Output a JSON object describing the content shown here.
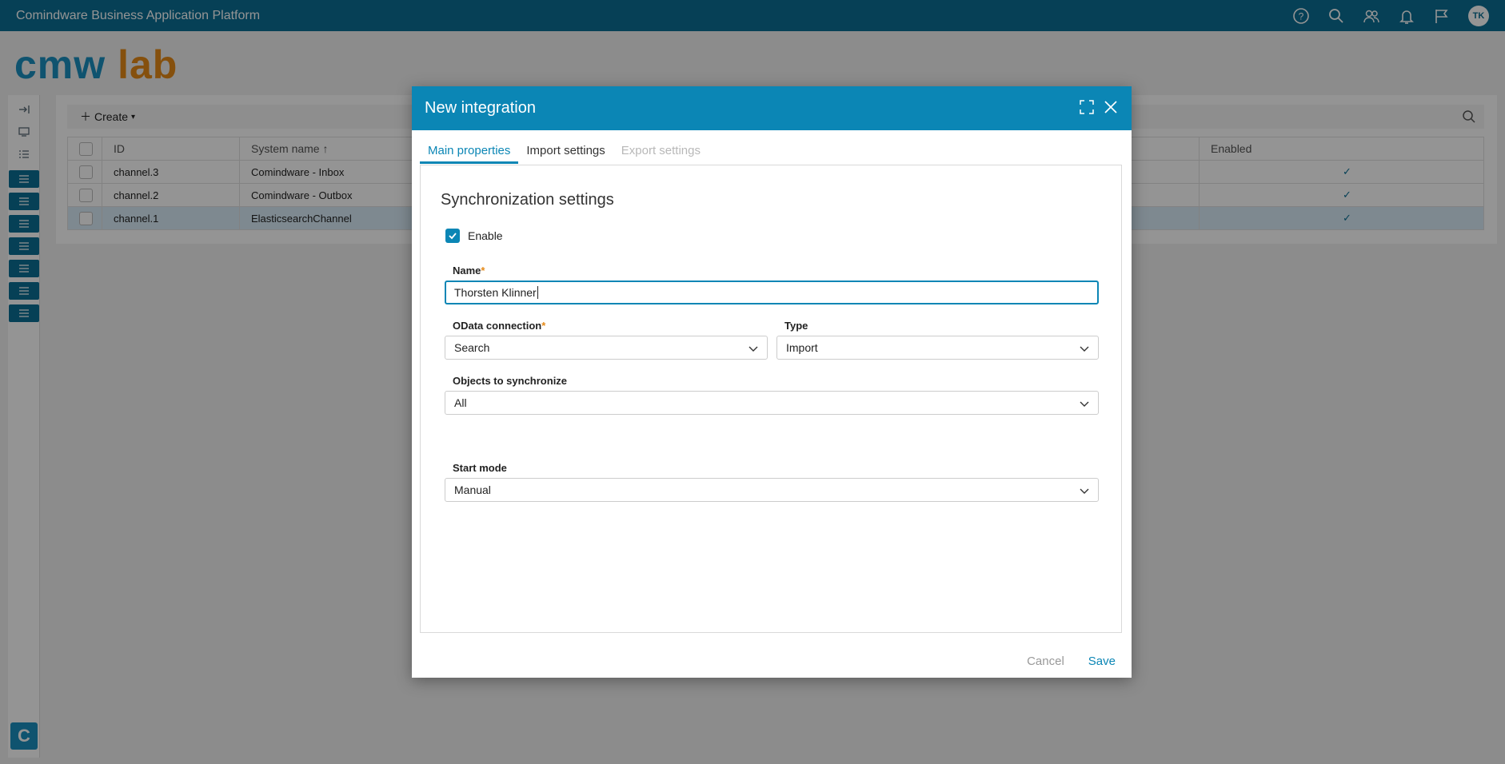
{
  "app": {
    "title": "Comindware Business Application Platform",
    "avatar": "TK"
  },
  "logo": {
    "part1": "cmw",
    "part2": "lab"
  },
  "toolbar": {
    "create_label": "Create"
  },
  "table": {
    "headers": {
      "id": "ID",
      "system_name": "System name ↑",
      "enabled": "Enabled"
    },
    "rows": [
      {
        "id": "channel.3",
        "system_name": "Comindware - Inbox",
        "enabled": "✓"
      },
      {
        "id": "channel.2",
        "system_name": "Comindware - Outbox",
        "enabled": "✓"
      },
      {
        "id": "channel.1",
        "system_name": "ElasticsearchChannel",
        "enabled": "✓"
      }
    ]
  },
  "dialog": {
    "title": "New integration",
    "tabs": [
      "Main properties",
      "Import settings",
      "Export settings"
    ],
    "section_title": "Synchronization settings",
    "enable_label": "Enable",
    "name_label": "Name",
    "name_value": "Thorsten Klinner",
    "odata_label": "OData connection",
    "odata_value": "Search",
    "type_label": "Type",
    "type_value": "Import",
    "objects_label": "Objects to synchronize",
    "objects_value": "All",
    "start_mode_label": "Start mode",
    "start_mode_value": "Manual",
    "required_mark": "*",
    "cancel_label": "Cancel",
    "save_label": "Save"
  },
  "colors": {
    "topbar": "#0b6f95",
    "accent": "#0b86b5",
    "logo_blue": "#1a8fc0",
    "logo_orange": "#e58a18"
  }
}
